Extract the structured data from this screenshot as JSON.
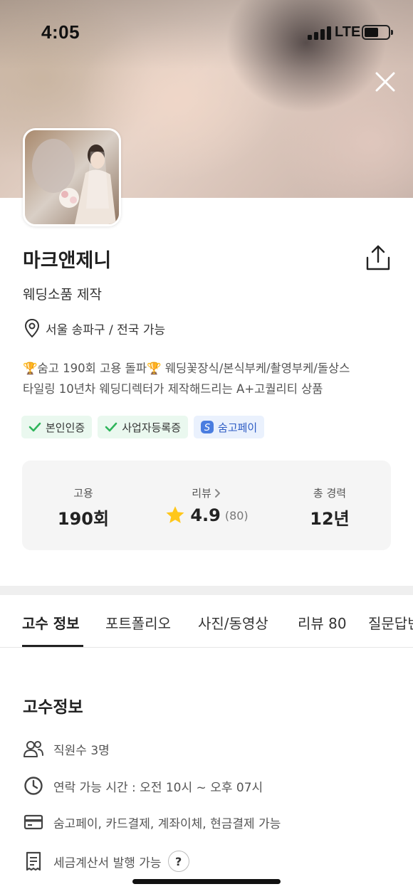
{
  "status_bar": {
    "time": "4:05",
    "network": "LTE",
    "battery_level": 0.5
  },
  "cover": {
    "description_icon": "cover-photo-image"
  },
  "header": {
    "close_icon": "close-icon",
    "share_icon": "share-icon"
  },
  "profile": {
    "name": "마크앤제니",
    "category": "웨딩소품 제작",
    "location": "서울 송파구 / 전국 가능",
    "intro_line1": "🏆숨고 190회 고용 돌파🏆 웨딩꽃장식/본식부케/촬영부케/돌상스",
    "intro_line2": "타일링 10년차 웨딩디렉터가 제작해드리는 A+고퀄리티 상품"
  },
  "badges": [
    {
      "label": "본인인증",
      "icon": "check-icon"
    },
    {
      "label": "사업자등록증",
      "icon": "check-icon"
    },
    {
      "label": "숨고페이",
      "icon": "soomgo-pay-icon"
    }
  ],
  "stats": {
    "hire": {
      "label": "고용",
      "value": "190회"
    },
    "review": {
      "label": "리뷰",
      "rating": "4.9",
      "count": "(80)"
    },
    "career": {
      "label": "총 경력",
      "value": "12년"
    }
  },
  "tabs": [
    {
      "label": "고수 정보",
      "active": true
    },
    {
      "label": "포트폴리오",
      "active": false
    },
    {
      "label": "사진/동영상",
      "active": false
    },
    {
      "label": "리뷰 80",
      "active": false
    },
    {
      "label": "질문답변",
      "active": false
    }
  ],
  "info_section": {
    "title": "고수정보",
    "rows": [
      {
        "icon": "people-icon",
        "text": "직원수 3명"
      },
      {
        "icon": "clock-icon",
        "text": "연락 가능 시간 : 오전 10시  ~ 오후 07시"
      },
      {
        "icon": "card-icon",
        "text": "숨고페이, 카드결제, 계좌이체, 현금결제 가능"
      },
      {
        "icon": "receipt-icon",
        "text": "세금계산서 발행 가능"
      }
    ],
    "help_label": "?"
  },
  "colors": {
    "accent_green": "#2fb55b",
    "accent_blue": "#2d5cc4",
    "star": "#ffc71b"
  }
}
